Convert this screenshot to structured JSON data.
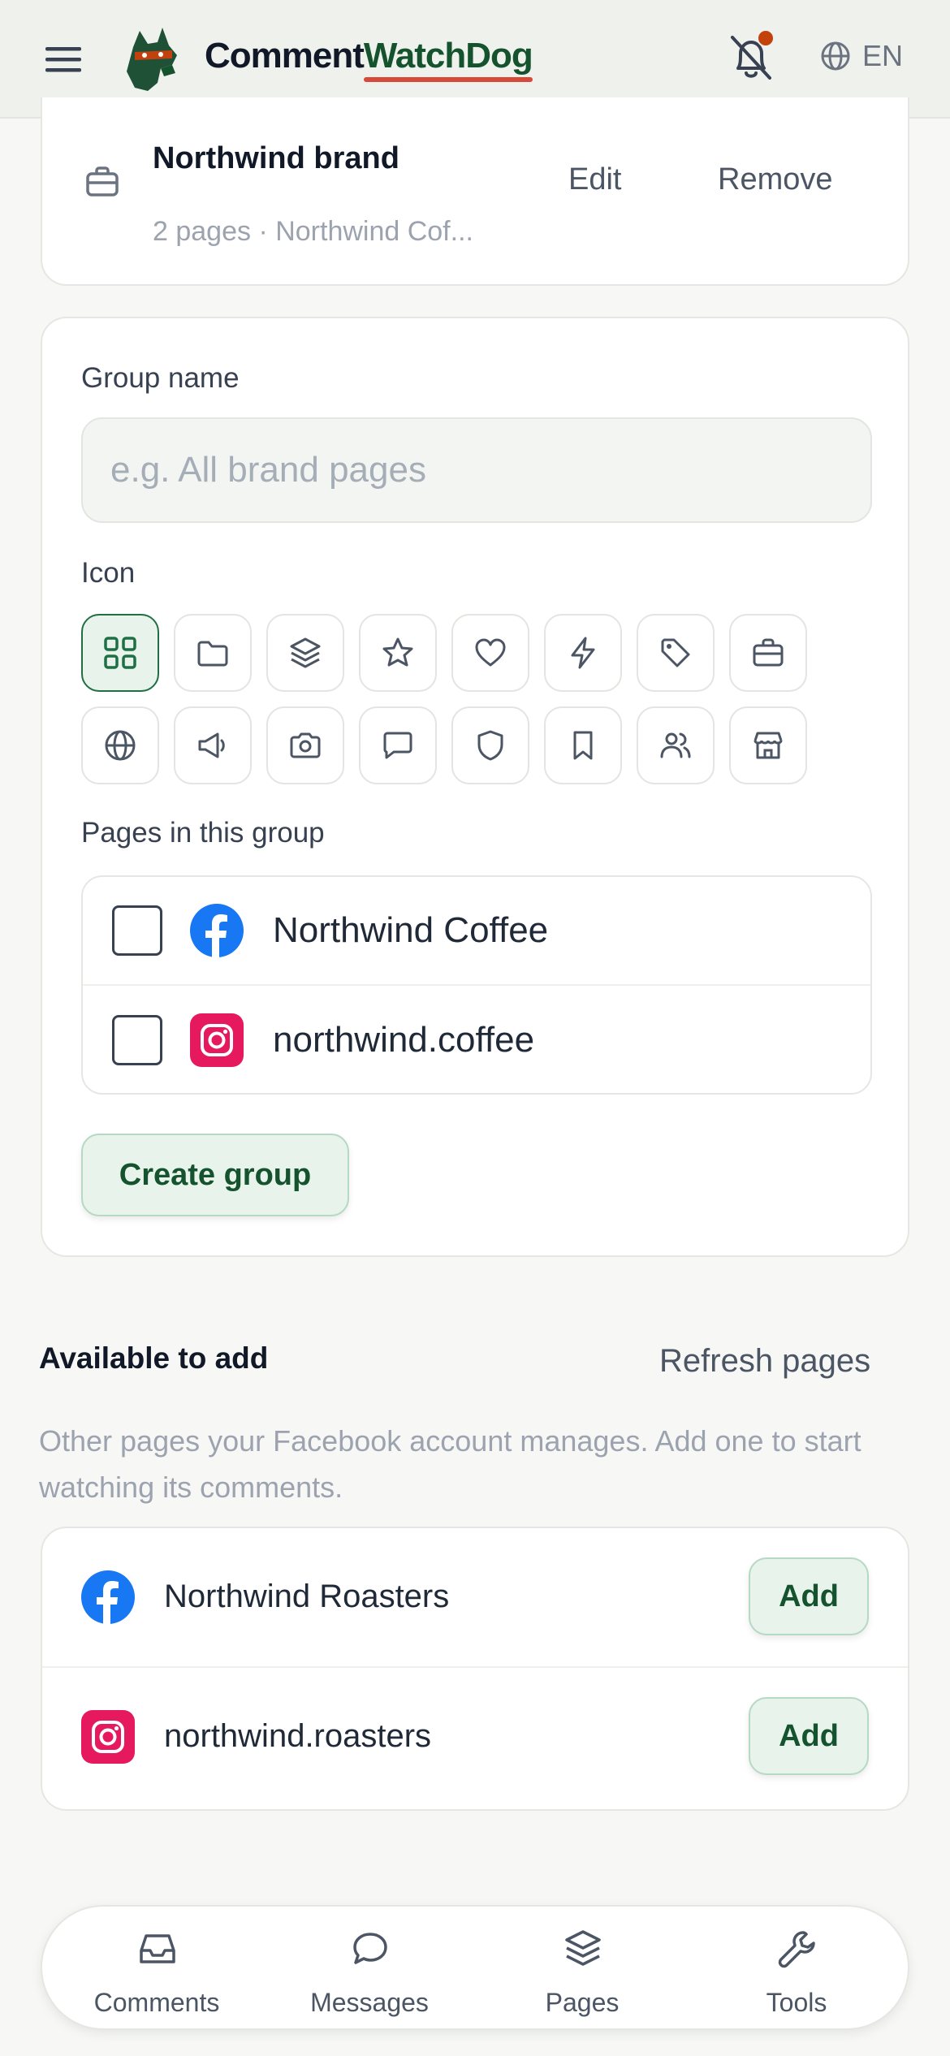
{
  "header": {
    "brand_part1": "Comment",
    "brand_part2": "WatchDog",
    "lang": "EN",
    "accent_color": "#14532d",
    "notification_dot_color": "#c2410c"
  },
  "existing_group": {
    "title": "Northwind brand",
    "subtitle": "2 pages · Northwind Cof...",
    "icon": "briefcase-icon",
    "edit_label": "Edit",
    "remove_label": "Remove"
  },
  "form": {
    "group_name_label": "Group name",
    "group_name_placeholder": "e.g. All brand pages",
    "group_name_value": "",
    "icon_label": "Icon",
    "icons": [
      {
        "name": "grid-icon",
        "selected": true
      },
      {
        "name": "folder-icon",
        "selected": false
      },
      {
        "name": "layers-icon",
        "selected": false
      },
      {
        "name": "star-icon",
        "selected": false
      },
      {
        "name": "heart-icon",
        "selected": false
      },
      {
        "name": "bolt-icon",
        "selected": false
      },
      {
        "name": "tag-icon",
        "selected": false
      },
      {
        "name": "briefcase-icon",
        "selected": false
      },
      {
        "name": "globe-icon",
        "selected": false
      },
      {
        "name": "megaphone-icon",
        "selected": false
      },
      {
        "name": "camera-icon",
        "selected": false
      },
      {
        "name": "chat-icon",
        "selected": false
      },
      {
        "name": "shield-icon",
        "selected": false
      },
      {
        "name": "bookmark-icon",
        "selected": false
      },
      {
        "name": "users-icon",
        "selected": false
      },
      {
        "name": "store-icon",
        "selected": false
      }
    ],
    "pages_label": "Pages in this group",
    "pages": [
      {
        "name": "Northwind Coffee",
        "platform": "facebook",
        "checked": false
      },
      {
        "name": "northwind.coffee",
        "platform": "instagram",
        "checked": false
      }
    ],
    "create_label": "Create group"
  },
  "available": {
    "title": "Available to add",
    "refresh_label": "Refresh pages",
    "description": "Other pages your Facebook account manages. Add one to start watching its comments.",
    "items": [
      {
        "name": "Northwind Roasters",
        "platform": "facebook",
        "add_label": "Add"
      },
      {
        "name": "northwind.roasters",
        "platform": "instagram",
        "add_label": "Add"
      }
    ]
  },
  "nav": {
    "items": [
      {
        "label": "Comments",
        "icon": "inbox-icon"
      },
      {
        "label": "Messages",
        "icon": "message-bubble-icon"
      },
      {
        "label": "Pages",
        "icon": "layers-icon"
      },
      {
        "label": "Tools",
        "icon": "wrench-icon"
      }
    ]
  }
}
